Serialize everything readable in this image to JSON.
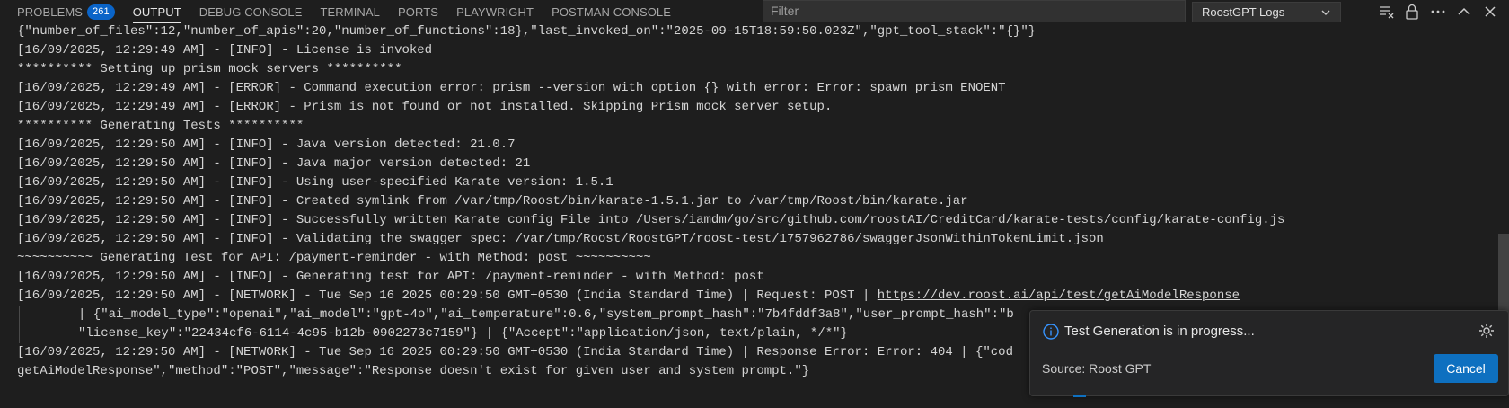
{
  "tabs": [
    {
      "label": "PROBLEMS",
      "badge": "261"
    },
    {
      "label": "OUTPUT"
    },
    {
      "label": "DEBUG CONSOLE"
    },
    {
      "label": "TERMINAL"
    },
    {
      "label": "PORTS"
    },
    {
      "label": "PLAYWRIGHT"
    },
    {
      "label": "POSTMAN CONSOLE"
    }
  ],
  "active_tab": "OUTPUT",
  "filter": {
    "placeholder": "Filter",
    "value": ""
  },
  "channel_select": {
    "value": "RoostGPT Logs"
  },
  "header_icons": [
    "clear-output-icon",
    "lock-icon",
    "more-actions-icon",
    "chevron-up-icon",
    "close-icon"
  ],
  "log_lines": [
    "{\"number_of_files\":12,\"number_of_apis\":20,\"number_of_functions\":18},\"last_invoked_on\":\"2025-09-15T18:59:50.023Z\",\"gpt_tool_stack\":\"{}\"}",
    "[16/09/2025, 12:29:49 AM] - [INFO] - License is invoked",
    "********** Setting up prism mock servers **********",
    "[16/09/2025, 12:29:49 AM] - [ERROR] - Command execution error: prism --version with option {} with error: Error: spawn prism ENOENT",
    "[16/09/2025, 12:29:49 AM] - [ERROR] - Prism is not found or not installed. Skipping Prism mock server setup.",
    "********** Generating Tests **********",
    "[16/09/2025, 12:29:50 AM] - [INFO] - Java version detected: 21.0.7",
    "[16/09/2025, 12:29:50 AM] - [INFO] - Java major version detected: 21",
    "[16/09/2025, 12:29:50 AM] - [INFO] - Using user-specified Karate version: 1.5.1",
    "[16/09/2025, 12:29:50 AM] - [INFO] - Created symlink from /var/tmp/Roost/bin/karate-1.5.1.jar to /var/tmp/Roost/bin/karate.jar",
    "[16/09/2025, 12:29:50 AM] - [INFO] - Successfully written Karate config File into /Users/iamdm/go/src/github.com/roostAI/CreditCard/karate-tests/config/karate-config.js",
    "[16/09/2025, 12:29:50 AM] - [INFO] - Validating the swagger spec: /var/tmp/Roost/RoostGPT/roost-test/1757962786/swaggerJsonWithinTokenLimit.json",
    "~~~~~~~~~~ Generating Test for API: /payment-reminder - with Method: post ~~~~~~~~~~",
    "[16/09/2025, 12:29:50 AM] - [INFO] - Generating test for API: /payment-reminder - with Method: post"
  ],
  "network_request": {
    "prefix": "[16/09/2025, 12:29:50 AM] - [NETWORK] - Tue Sep 16 2025 00:29:50 GMT+0530 (India Standard Time) | Request: POST | ",
    "url": "https://dev.roost.ai/api/test/getAiModelResponse",
    "cont1": "| {\"ai_model_type\":\"openai\",\"ai_model\":\"gpt-4o\",\"ai_temperature\":0.6,\"system_prompt_hash\":\"7b4fddf3a8\",\"user_prompt_hash\":\"b",
    "cont2": "\"license_key\":\"22434cf6-6114-4c95-b12b-0902273c7159\"} | {\"Accept\":\"application/json, text/plain, */*\"}"
  },
  "network_error": {
    "line1": "[16/09/2025, 12:29:50 AM] - [NETWORK] - Tue Sep 16 2025 00:29:50 GMT+0530 (India Standard Time) | Response Error: Error: 404 | {\"cod",
    "line2": "getAiModelResponse\",\"method\":\"POST\",\"message\":\"Response doesn't exist for given user and system prompt.\"}"
  },
  "toast": {
    "message": "Test Generation is in progress...",
    "source": "Source: Roost GPT",
    "cancel_label": "Cancel"
  },
  "colors": {
    "accent": "#0e70c0",
    "badge": "#0a64c8",
    "background": "#1e1e1e"
  }
}
